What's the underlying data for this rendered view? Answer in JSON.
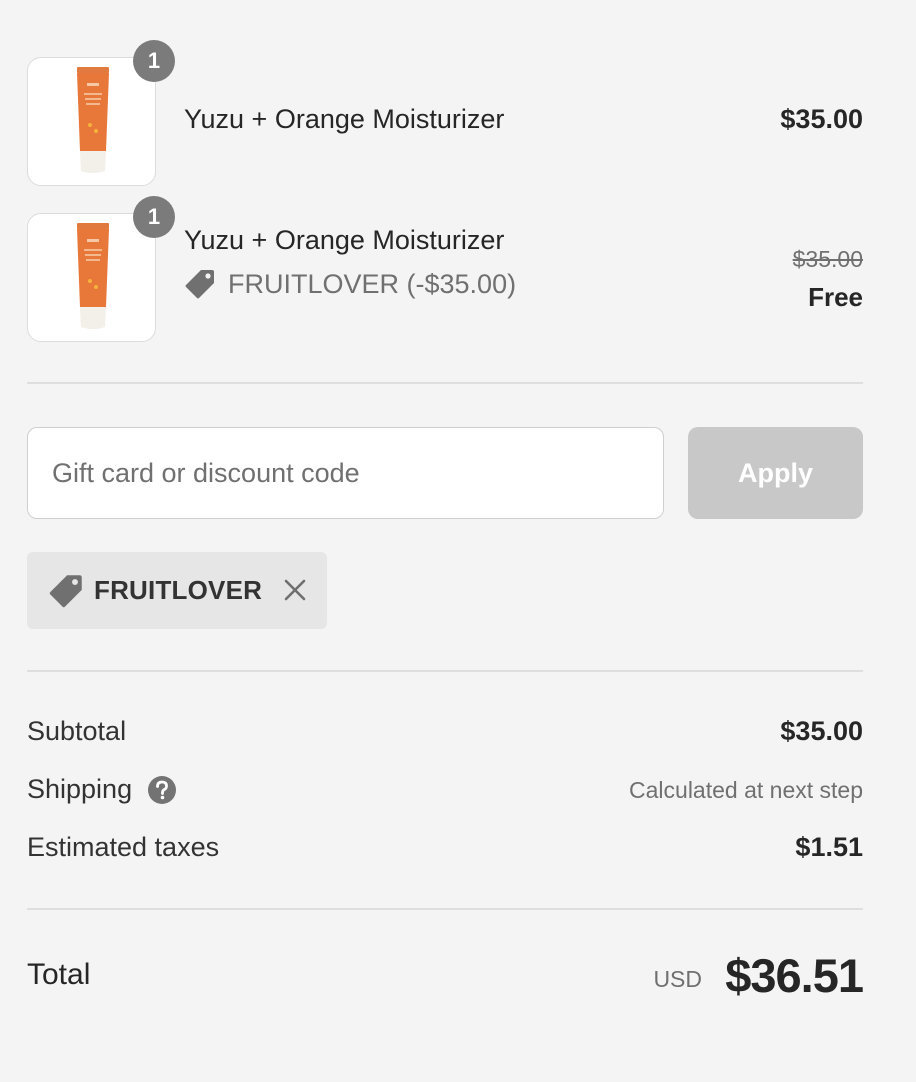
{
  "line_items": [
    {
      "quantity": "1",
      "name": "Yuzu + Orange Moisturizer",
      "price": "$35.00",
      "image_icon": "moisturizer-tube"
    },
    {
      "quantity": "1",
      "name": "Yuzu + Orange Moisturizer",
      "discount": "FRUITLOVER (-$35.00)",
      "original_price": "$35.00",
      "price": "Free",
      "image_icon": "moisturizer-tube"
    }
  ],
  "discount_form": {
    "placeholder": "Gift card or discount code",
    "value": "",
    "apply_label": "Apply"
  },
  "applied_discount": {
    "code": "FRUITLOVER",
    "tag_icon": "tag-icon",
    "remove_icon": "close-icon"
  },
  "summary": {
    "subtotal_label": "Subtotal",
    "subtotal_value": "$35.00",
    "shipping_label": "Shipping",
    "shipping_help_icon": "question-icon",
    "shipping_value": "Calculated at next step",
    "taxes_label": "Estimated taxes",
    "taxes_value": "$1.51"
  },
  "total": {
    "label": "Total",
    "currency": "USD",
    "amount": "$36.51"
  },
  "colors": {
    "background": "#f4f4f4",
    "badge": "#7b7b7b",
    "apply_disabled": "#c8c8c8",
    "chip_background": "#e6e6e6",
    "product_orange": "#e8773a"
  }
}
